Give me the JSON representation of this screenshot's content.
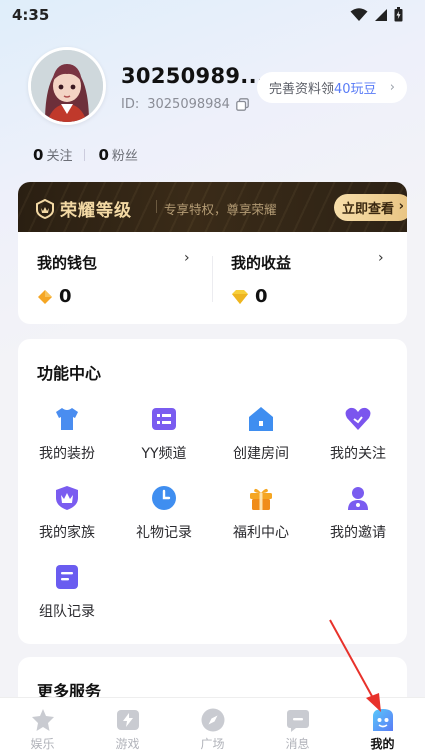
{
  "status_bar": {
    "time": "4:35"
  },
  "profile": {
    "username": "30250989...",
    "id_label": "ID:",
    "id_value": "3025098984",
    "pill_prefix": "完善资料领",
    "pill_highlight": "40玩豆",
    "following_count": "0",
    "following_label": "关注",
    "fans_count": "0",
    "fans_label": "粉丝"
  },
  "vip": {
    "title": "荣耀等级",
    "subtitle": "专享特权，尊享荣耀",
    "button": "立即查看"
  },
  "wallet": {
    "left_title": "我的钱包",
    "left_value": "0",
    "right_title": "我的收益",
    "right_value": "0"
  },
  "features": {
    "title": "功能中心",
    "items": [
      {
        "label": "我的装扮",
        "icon": "shirt-icon"
      },
      {
        "label": "YY频道",
        "icon": "channel-list-icon"
      },
      {
        "label": "创建房间",
        "icon": "house-icon"
      },
      {
        "label": "我的关注",
        "icon": "heart-icon"
      },
      {
        "label": "我的家族",
        "icon": "shield-crown-icon"
      },
      {
        "label": "礼物记录",
        "icon": "clock-icon"
      },
      {
        "label": "福利中心",
        "icon": "gift-icon"
      },
      {
        "label": "我的邀请",
        "icon": "person-icon"
      },
      {
        "label": "组队记录",
        "icon": "document-icon"
      }
    ]
  },
  "more": {
    "title": "更多服务"
  },
  "tabbar": {
    "tabs": [
      {
        "label": "娱乐",
        "icon": "star-icon"
      },
      {
        "label": "游戏",
        "icon": "lightning-icon"
      },
      {
        "label": "广场",
        "icon": "compass-icon"
      },
      {
        "label": "消息",
        "icon": "message-icon"
      },
      {
        "label": "我的",
        "icon": "profile-icon"
      }
    ],
    "active_index": 4
  },
  "colors": {
    "accent": "#5a7cf6",
    "vip_gold": "#f3d9a4",
    "annotation_arrow": "#e8322b"
  }
}
